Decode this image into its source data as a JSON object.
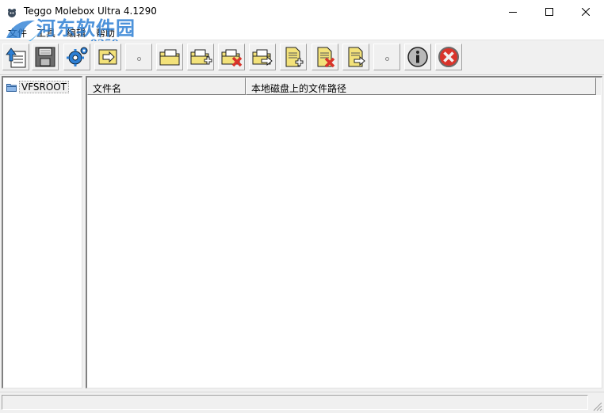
{
  "window": {
    "title": "Teggo Molebox Ultra 4.1290"
  },
  "watermark": {
    "main": "河东软件园",
    "url": "www.pc0359.cn"
  },
  "menu": {
    "items": [
      {
        "label": "文件"
      },
      {
        "label": "工具"
      },
      {
        "label": "编辑"
      },
      {
        "label": "帮助"
      }
    ]
  },
  "toolbar": {
    "buttons": [
      {
        "icon": "upload-document-icon"
      },
      {
        "icon": "save-disk-icon"
      },
      {
        "icon": "settings-gear-icon"
      },
      {
        "icon": "arrow-right-icon"
      },
      {
        "icon": "separator"
      },
      {
        "icon": "folder-icon"
      },
      {
        "icon": "folder-add-icon"
      },
      {
        "icon": "folder-delete-icon"
      },
      {
        "icon": "folder-export-icon"
      },
      {
        "icon": "file-add-icon"
      },
      {
        "icon": "file-delete-icon"
      },
      {
        "icon": "file-export-icon"
      },
      {
        "icon": "separator"
      },
      {
        "icon": "info-icon"
      },
      {
        "icon": "close-red-icon"
      }
    ]
  },
  "tree": {
    "root_label": "VFSROOT"
  },
  "list": {
    "columns": [
      {
        "label": "文件名"
      },
      {
        "label": "本地磁盘上的文件路径"
      }
    ],
    "rows": []
  },
  "colors": {
    "accent_blue": "#2d7fd4",
    "chrome": "#f0f0f0",
    "delete_red": "#d9342b",
    "file_yellow": "#f3e27a"
  }
}
